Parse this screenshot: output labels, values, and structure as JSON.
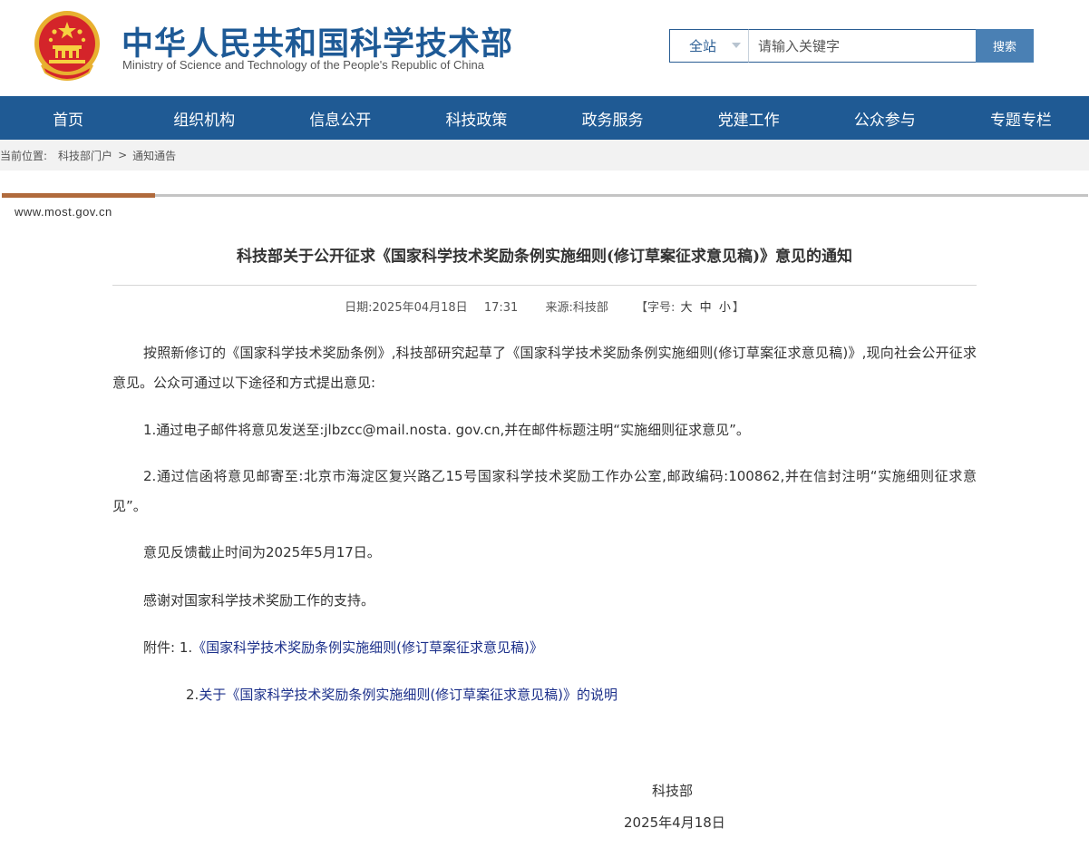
{
  "header": {
    "title": "中华人民共和国科学技术部",
    "subtitle": "Ministry of Science and Technology of the People's Republic of China",
    "search": {
      "scope": "全站",
      "placeholder": "请输入关键字",
      "button": "搜索"
    }
  },
  "nav": [
    {
      "label": "首页"
    },
    {
      "label": "组织机构"
    },
    {
      "label": "信息公开"
    },
    {
      "label": "科技政策"
    },
    {
      "label": "政务服务"
    },
    {
      "label": "党建工作"
    },
    {
      "label": "公众参与"
    },
    {
      "label": "专题专栏"
    }
  ],
  "breadcrumb": {
    "label": "当前位置:",
    "items": [
      "科技部门户",
      "通知通告"
    ],
    "separator": ">"
  },
  "site_url": "www.most.gov.cn",
  "article": {
    "title": "科技部关于公开征求《国家科学技术奖励条例实施细则(修订草案征求意见稿)》意见的通知",
    "meta": {
      "date_label": "日期:",
      "date": "2025年04月18日",
      "time": "17:31",
      "source_label": "来源:",
      "source": "科技部",
      "font_label": "【字号:",
      "font_large": "大",
      "font_medium": "中",
      "font_small": "小",
      "font_close": "】"
    },
    "paragraphs": {
      "intro": "按照新修订的《国家科学技术奖励条例》,科技部研究起草了《国家科学技术奖励条例实施细则(修订草案征求意见稿)》,现向社会公开征求意见。公众可通过以下途径和方式提出意见:",
      "item1": "1.通过电子邮件将意见发送至:jlbzcc@mail.nosta. gov.cn,并在邮件标题注明“实施细则征求意见”。",
      "item2": "2.通过信函将意见邮寄至:北京市海淀区复兴路乙15号国家科学技术奖励工作办公室,邮政编码:100862,并在信封注明“实施细则征求意见”。",
      "deadline": "意见反馈截止时间为2025年5月17日。",
      "thanks": "感谢对国家科学技术奖励工作的支持。"
    },
    "attachments": {
      "label": "附件:",
      "items": [
        {
          "prefix": "1.",
          "title": "《国家科学技术奖励条例实施细则(修订草案征求意见稿)》"
        },
        {
          "prefix": "2.",
          "title": "关于《国家科学技术奖励条例实施细则(修订草案征求意见稿)》的说明"
        }
      ]
    },
    "signature": {
      "org": "科技部",
      "date": "2025年4月18日"
    }
  },
  "colors": {
    "brand": "#1e5a96",
    "nav_bg": "#1f5a94",
    "accent_bar": "#b06a3c",
    "link": "#1b2f8a"
  }
}
